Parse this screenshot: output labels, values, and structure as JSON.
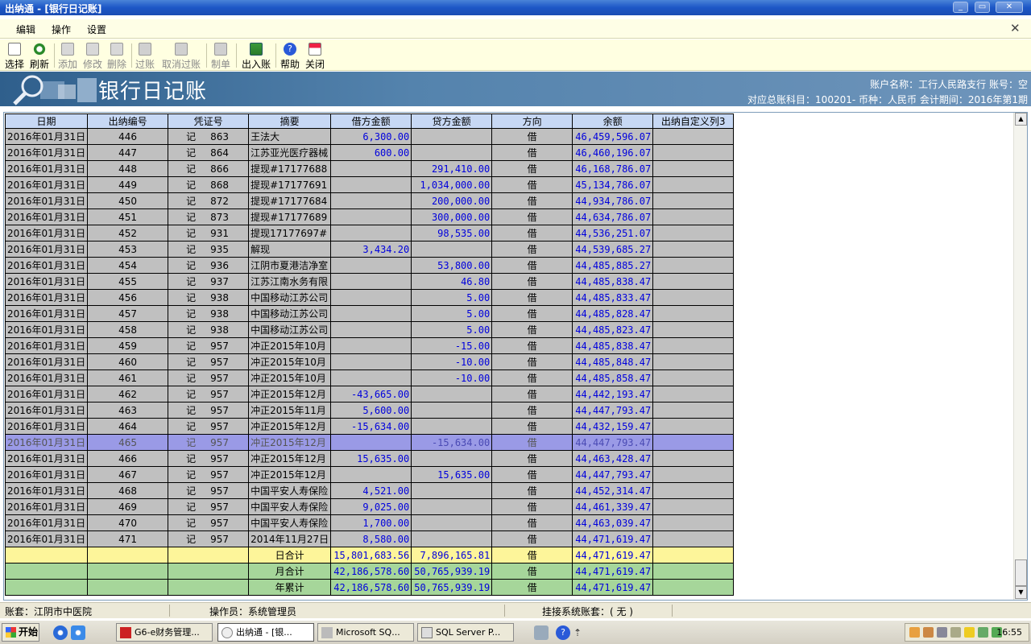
{
  "window": {
    "title": "出纳通 - [银行日记账]"
  },
  "menu": {
    "items": [
      "编辑",
      "操作",
      "设置"
    ]
  },
  "toolbar": {
    "buttons": [
      {
        "label": "选择",
        "icon": "select-icon",
        "enabled": true
      },
      {
        "label": "刷新",
        "icon": "refresh-icon",
        "enabled": true
      },
      {
        "label": "添加",
        "icon": "add-icon",
        "enabled": false
      },
      {
        "label": "修改",
        "icon": "edit-icon",
        "enabled": false
      },
      {
        "label": "删除",
        "icon": "delete-icon",
        "enabled": false
      },
      {
        "label": "过账",
        "icon": "post-icon",
        "enabled": false
      },
      {
        "label": "取消过账",
        "icon": "unpost-icon",
        "enabled": false
      },
      {
        "label": "制单",
        "icon": "voucher-icon",
        "enabled": false
      },
      {
        "label": "出入账",
        "icon": "inout-icon",
        "enabled": true
      },
      {
        "label": "帮助",
        "icon": "help-icon",
        "enabled": true
      },
      {
        "label": "关闭",
        "icon": "close-icon",
        "enabled": true
      }
    ]
  },
  "banner": {
    "title": "银行日记账",
    "account_line": "账户名称：工行人民路支行   账号：空",
    "subject_line": "对应总账科目：100201-   币种：人民币   会计期间：2016年第1期"
  },
  "grid": {
    "columns": [
      "日期",
      "出纳编号",
      "凭证号",
      "摘要",
      "借方金额",
      "贷方金额",
      "方向",
      "余额",
      "出纳自定义列3"
    ],
    "rows": [
      {
        "date": "2016年01月31日",
        "no": "446",
        "vtype": "记",
        "vno": "863",
        "summary": "王法大",
        "debit": "6,300.00",
        "credit": "",
        "dir": "借",
        "balance": "46,459,596.07"
      },
      {
        "date": "2016年01月31日",
        "no": "447",
        "vtype": "记",
        "vno": "864",
        "summary": "江苏亚光医疗器械",
        "debit": "600.00",
        "credit": "",
        "dir": "借",
        "balance": "46,460,196.07"
      },
      {
        "date": "2016年01月31日",
        "no": "448",
        "vtype": "记",
        "vno": "866",
        "summary": "提现#17177688",
        "debit": "",
        "credit": "291,410.00",
        "dir": "借",
        "balance": "46,168,786.07"
      },
      {
        "date": "2016年01月31日",
        "no": "449",
        "vtype": "记",
        "vno": "868",
        "summary": "提现#17177691",
        "debit": "",
        "credit": "1,034,000.00",
        "dir": "借",
        "balance": "45,134,786.07"
      },
      {
        "date": "2016年01月31日",
        "no": "450",
        "vtype": "记",
        "vno": "872",
        "summary": "提现#17177684",
        "debit": "",
        "credit": "200,000.00",
        "dir": "借",
        "balance": "44,934,786.07"
      },
      {
        "date": "2016年01月31日",
        "no": "451",
        "vtype": "记",
        "vno": "873",
        "summary": "提现#17177689",
        "debit": "",
        "credit": "300,000.00",
        "dir": "借",
        "balance": "44,634,786.07"
      },
      {
        "date": "2016年01月31日",
        "no": "452",
        "vtype": "记",
        "vno": "931",
        "summary": "提现17177697#",
        "debit": "",
        "credit": "98,535.00",
        "dir": "借",
        "balance": "44,536,251.07"
      },
      {
        "date": "2016年01月31日",
        "no": "453",
        "vtype": "记",
        "vno": "935",
        "summary": "解现",
        "debit": "3,434.20",
        "credit": "",
        "dir": "借",
        "balance": "44,539,685.27"
      },
      {
        "date": "2016年01月31日",
        "no": "454",
        "vtype": "记",
        "vno": "936",
        "summary": "江阴市夏港洁净室",
        "debit": "",
        "credit": "53,800.00",
        "dir": "借",
        "balance": "44,485,885.27"
      },
      {
        "date": "2016年01月31日",
        "no": "455",
        "vtype": "记",
        "vno": "937",
        "summary": "江苏江南水务有限",
        "debit": "",
        "credit": "46.80",
        "dir": "借",
        "balance": "44,485,838.47"
      },
      {
        "date": "2016年01月31日",
        "no": "456",
        "vtype": "记",
        "vno": "938",
        "summary": "中国移动江苏公司",
        "debit": "",
        "credit": "5.00",
        "dir": "借",
        "balance": "44,485,833.47"
      },
      {
        "date": "2016年01月31日",
        "no": "457",
        "vtype": "记",
        "vno": "938",
        "summary": "中国移动江苏公司",
        "debit": "",
        "credit": "5.00",
        "dir": "借",
        "balance": "44,485,828.47"
      },
      {
        "date": "2016年01月31日",
        "no": "458",
        "vtype": "记",
        "vno": "938",
        "summary": "中国移动江苏公司",
        "debit": "",
        "credit": "5.00",
        "dir": "借",
        "balance": "44,485,823.47"
      },
      {
        "date": "2016年01月31日",
        "no": "459",
        "vtype": "记",
        "vno": "957",
        "summary": "冲正2015年10月",
        "debit": "",
        "credit": "-15.00",
        "dir": "借",
        "balance": "44,485,838.47"
      },
      {
        "date": "2016年01月31日",
        "no": "460",
        "vtype": "记",
        "vno": "957",
        "summary": "冲正2015年10月",
        "debit": "",
        "credit": "-10.00",
        "dir": "借",
        "balance": "44,485,848.47"
      },
      {
        "date": "2016年01月31日",
        "no": "461",
        "vtype": "记",
        "vno": "957",
        "summary": "冲正2015年10月",
        "debit": "",
        "credit": "-10.00",
        "dir": "借",
        "balance": "44,485,858.47"
      },
      {
        "date": "2016年01月31日",
        "no": "462",
        "vtype": "记",
        "vno": "957",
        "summary": "冲正2015年12月",
        "debit": "-43,665.00",
        "credit": "",
        "dir": "借",
        "balance": "44,442,193.47"
      },
      {
        "date": "2016年01月31日",
        "no": "463",
        "vtype": "记",
        "vno": "957",
        "summary": "冲正2015年11月",
        "debit": "5,600.00",
        "credit": "",
        "dir": "借",
        "balance": "44,447,793.47"
      },
      {
        "date": "2016年01月31日",
        "no": "464",
        "vtype": "记",
        "vno": "957",
        "summary": "冲正2015年12月",
        "debit": "-15,634.00",
        "credit": "",
        "dir": "借",
        "balance": "44,432,159.47"
      },
      {
        "date": "2016年01月31日",
        "no": "465",
        "vtype": "记",
        "vno": "957",
        "summary": "冲正2015年12月",
        "debit": "",
        "credit": "-15,634.00",
        "dir": "借",
        "balance": "44,447,793.47",
        "selected": true
      },
      {
        "date": "2016年01月31日",
        "no": "466",
        "vtype": "记",
        "vno": "957",
        "summary": "冲正2015年12月",
        "debit": "15,635.00",
        "credit": "",
        "dir": "借",
        "balance": "44,463,428.47"
      },
      {
        "date": "2016年01月31日",
        "no": "467",
        "vtype": "记",
        "vno": "957",
        "summary": "冲正2015年12月",
        "debit": "",
        "credit": "15,635.00",
        "dir": "借",
        "balance": "44,447,793.47"
      },
      {
        "date": "2016年01月31日",
        "no": "468",
        "vtype": "记",
        "vno": "957",
        "summary": "中国平安人寿保险",
        "debit": "4,521.00",
        "credit": "",
        "dir": "借",
        "balance": "44,452,314.47"
      },
      {
        "date": "2016年01月31日",
        "no": "469",
        "vtype": "记",
        "vno": "957",
        "summary": "中国平安人寿保险",
        "debit": "9,025.00",
        "credit": "",
        "dir": "借",
        "balance": "44,461,339.47"
      },
      {
        "date": "2016年01月31日",
        "no": "470",
        "vtype": "记",
        "vno": "957",
        "summary": "中国平安人寿保险",
        "debit": "1,700.00",
        "credit": "",
        "dir": "借",
        "balance": "44,463,039.47"
      },
      {
        "date": "2016年01月31日",
        "no": "471",
        "vtype": "记",
        "vno": "957",
        "summary": "2014年11月27日",
        "debit": "8,580.00",
        "credit": "",
        "dir": "借",
        "balance": "44,471,619.47"
      }
    ],
    "totals": [
      {
        "label": "日合计",
        "debit": "15,801,683.56",
        "credit": "7,896,165.81",
        "dir": "借",
        "balance": "44,471,619.47",
        "kind": "day"
      },
      {
        "label": "月合计",
        "debit": "42,186,578.60",
        "credit": "50,765,939.19",
        "dir": "借",
        "balance": "44,471,619.47",
        "kind": "tot"
      },
      {
        "label": "年累计",
        "debit": "42,186,578.60",
        "credit": "50,765,939.19",
        "dir": "借",
        "balance": "44,471,619.47",
        "kind": "tot"
      }
    ]
  },
  "status": {
    "set": "账套：江阴市中医院",
    "operator": "操作员：系统管理员",
    "linked": "挂接系统账套：( 无 )"
  },
  "taskbar": {
    "start": "开始",
    "tasks": [
      {
        "label": "G6-e财务管理...",
        "active": false
      },
      {
        "label": "出纳通 - [银...",
        "active": true
      },
      {
        "label": "Microsoft SQ...",
        "active": false
      },
      {
        "label": "SQL Server P...",
        "active": false
      }
    ],
    "clock": "16:55"
  },
  "colors": {
    "selected_row": "#9a9ae6",
    "day_total_row": "#fdf59a",
    "month_total_row": "#a6d69a",
    "amount_text": "#0000dd"
  }
}
